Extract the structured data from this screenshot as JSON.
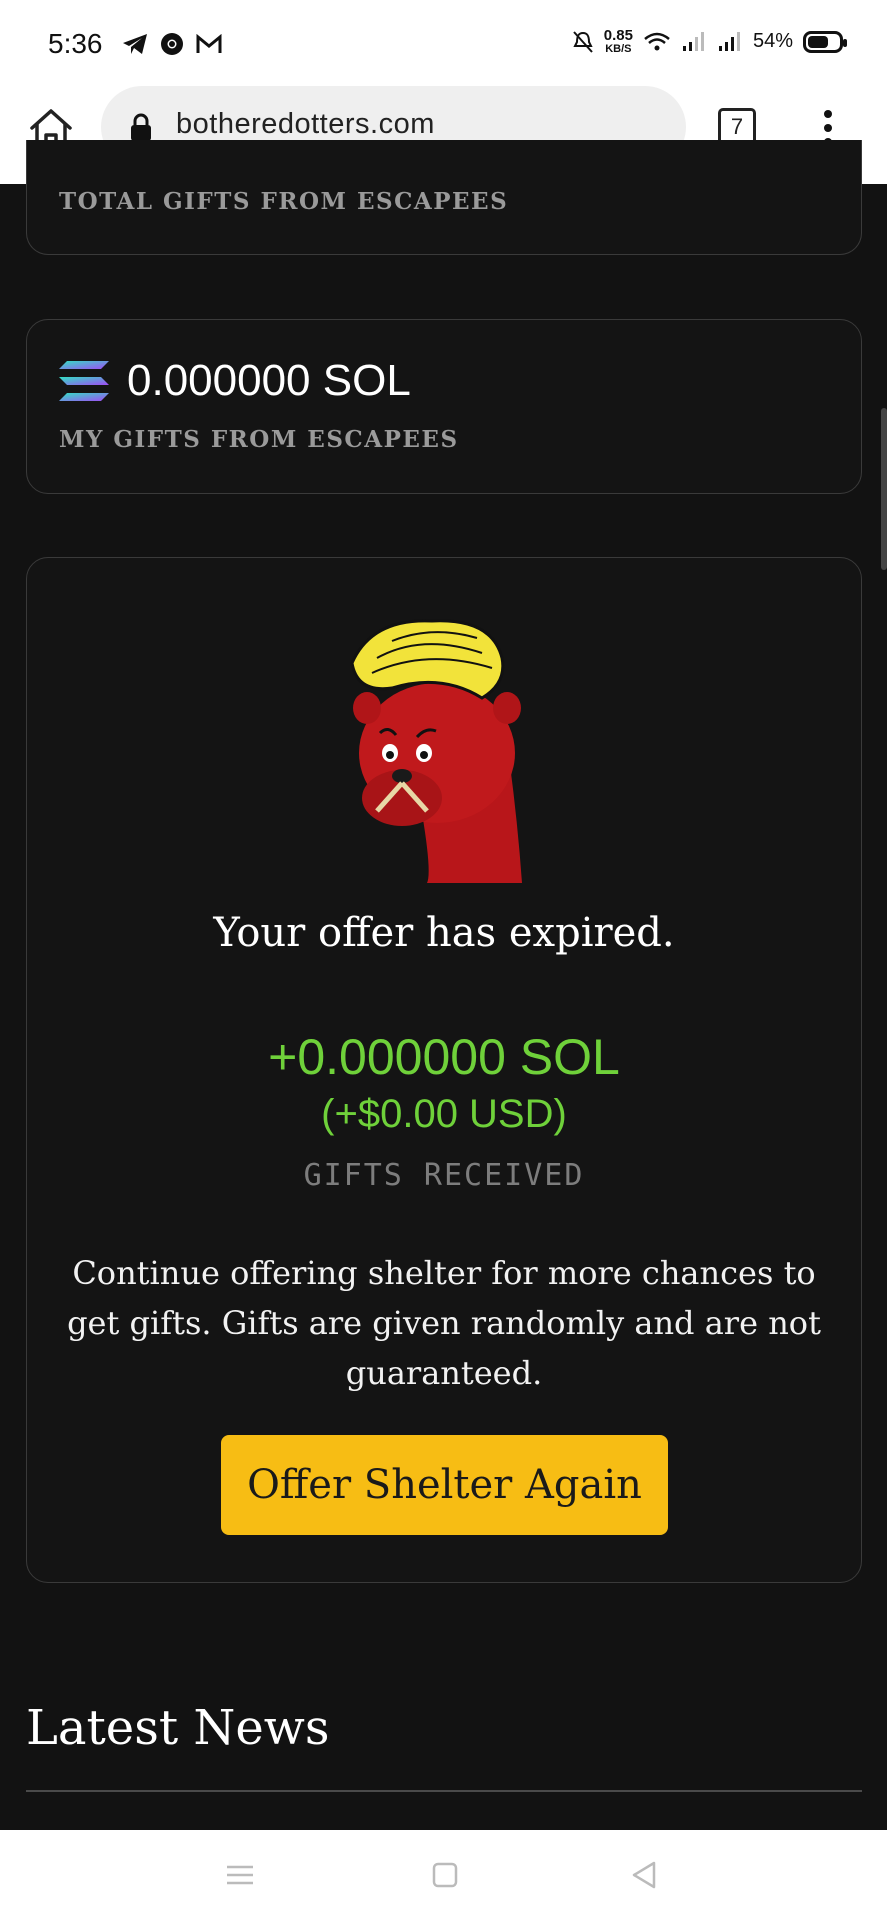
{
  "status_bar": {
    "time": "5:36",
    "net_speed": "0.85",
    "net_unit": "KB/S",
    "battery": "54%"
  },
  "browser": {
    "url": "botheredotters.com",
    "tab_count": "7"
  },
  "total_gifts": {
    "label": "TOTAL GIFTS FROM ESCAPEES"
  },
  "my_gifts": {
    "amount": "0.000000 SOL",
    "label": "MY GIFTS FROM ESCAPEES"
  },
  "offer": {
    "title": "Your offer has expired.",
    "gift_sol": "+0.000000 SOL",
    "gift_usd": "(+$0.00 USD)",
    "gift_label": "GIFTS RECEIVED",
    "description": "Continue offering shelter for more chances to get gifts. Gifts are given randomly and are not guaranteed.",
    "button_label": "Offer Shelter Again"
  },
  "news": {
    "title": "Latest News"
  },
  "colors": {
    "accent_yellow": "#f7bd14",
    "gift_green": "#6fd13a",
    "background": "#121212"
  }
}
